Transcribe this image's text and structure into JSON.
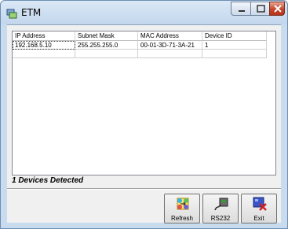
{
  "window": {
    "title": "ETM"
  },
  "device_list": {
    "columns": [
      "IP Address",
      "Subnet Mask",
      "MAC Address",
      "Device ID"
    ],
    "rows": [
      [
        "192.168.5.10",
        "255.255.255.0",
        "00-01-3D-71-3A-21",
        "1"
      ]
    ]
  },
  "status": {
    "text": "1 Devices Detected"
  },
  "toolbar": {
    "refresh_label": "Refresh",
    "rs232_label": "RS232",
    "exit_label": "Exit"
  },
  "colors": {
    "frame": "#c9dbee",
    "titlebar": "#d0e0f2",
    "close": "#c4462c",
    "client": "#f0f0f0"
  },
  "icons": [
    "app-icon",
    "minimize-icon",
    "maximize-icon",
    "close-icon",
    "refresh-icon",
    "rs232-icon",
    "exit-icon"
  ]
}
